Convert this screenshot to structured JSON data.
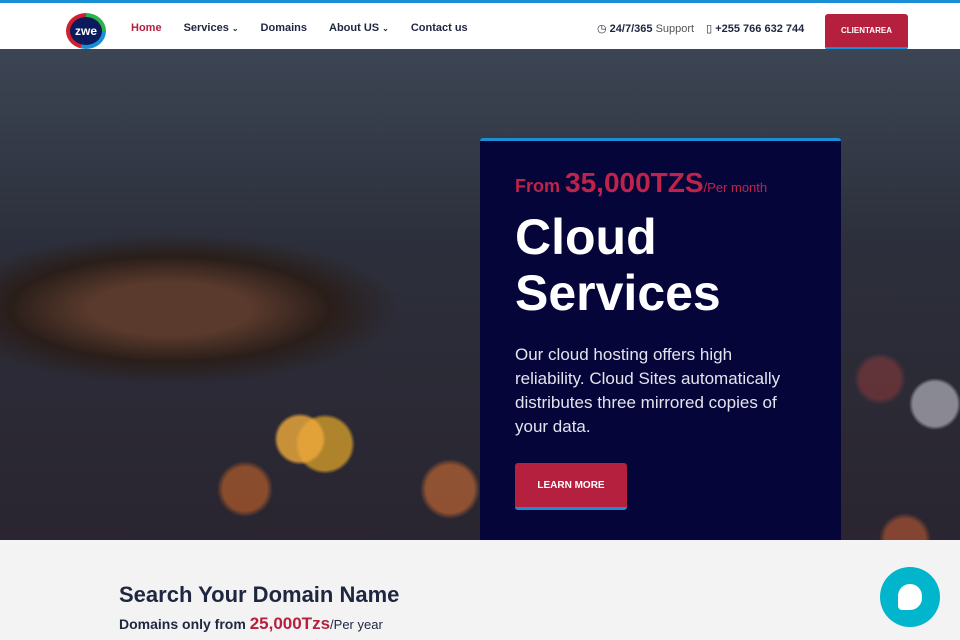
{
  "header": {
    "logo_text": "zwe",
    "nav": [
      {
        "label": "Home"
      },
      {
        "label": "Services"
      },
      {
        "label": "Domains"
      },
      {
        "label": "About US"
      },
      {
        "label": "Contact us"
      }
    ],
    "support_hours": "24/7/365",
    "support_label": "Support",
    "phone": "+255 766 632 744",
    "client_button": "CLIENTAREA"
  },
  "hero": {
    "from": "From",
    "price": "35,000TZS",
    "period": "/Per month",
    "title_line1": "Cloud",
    "title_line2": "Services",
    "description": "Our cloud hosting offers high reliability. Cloud Sites automatically distributes three mirrored copies of your data.",
    "cta": "LEARN MORE"
  },
  "domain": {
    "title": "Search Your Domain Name",
    "prefix": "Domains only from",
    "price": "25,000Tzs",
    "period": "/Per year"
  },
  "colors": {
    "accent": "#b5203f",
    "blue": "#1a8fd6",
    "navy": "#05053a",
    "chat": "#00b5cc"
  }
}
